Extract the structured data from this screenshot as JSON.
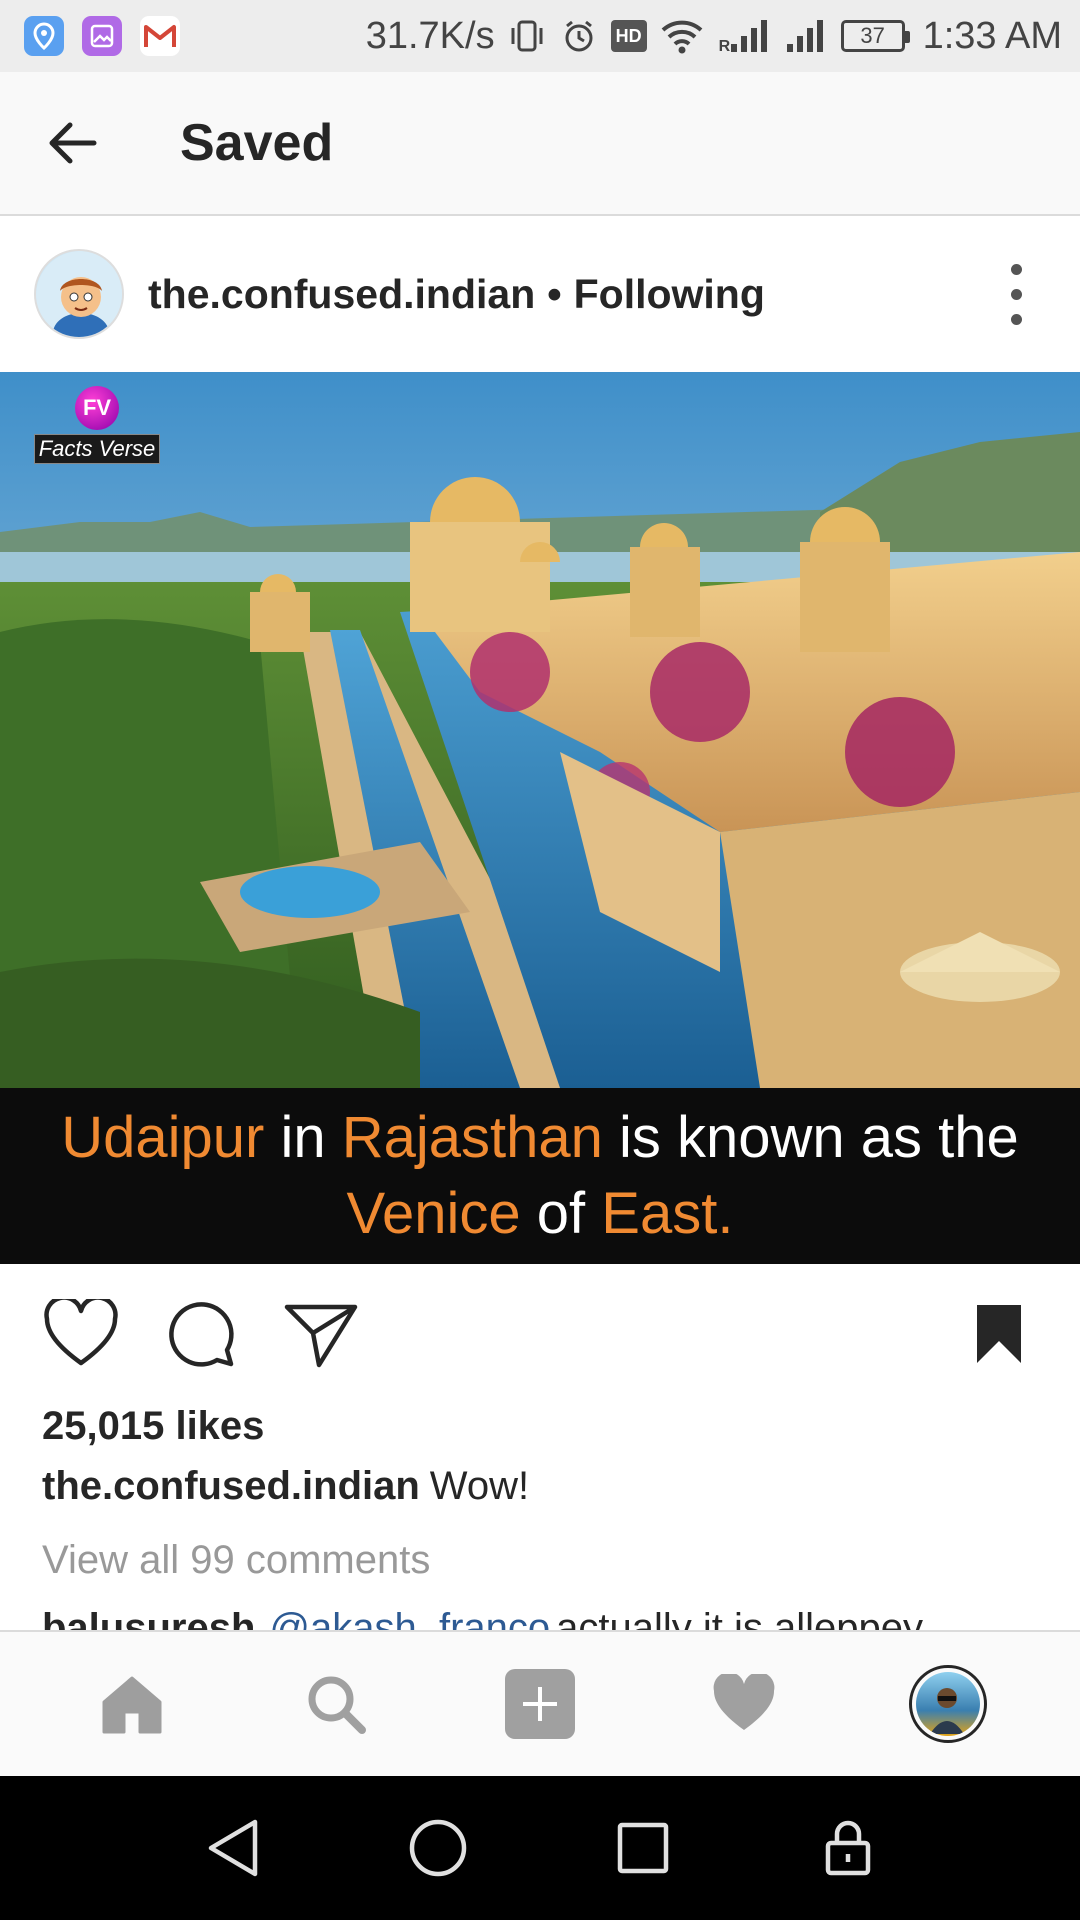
{
  "status_bar": {
    "net_speed": "31.7K/s",
    "hd_label": "HD",
    "signal_roaming_label": "R",
    "battery_level": "37",
    "time": "1:33 AM",
    "app_icons": [
      "maps-icon",
      "gallery-icon",
      "gmail-icon"
    ]
  },
  "header": {
    "title": "Saved"
  },
  "post": {
    "username": "the.confused.indian",
    "separator": "•",
    "follow_status": "Following",
    "image": {
      "watermark_initials": "FV",
      "watermark_text": "Facts Verse",
      "caption_line1": {
        "w1": "Udaipur",
        "w2": " in ",
        "w3": "Rajasthan",
        "w4": " is known as the"
      },
      "caption_line2": {
        "w1": "Venice",
        "w2": " of ",
        "w3": "East."
      }
    },
    "likes": "25,015 likes",
    "caption_user": "the.confused.indian",
    "caption_text": "Wow!",
    "view_comments": "View all 99 comments",
    "comment_peek": {
      "user": "balusuresh",
      "mention": "@akash_franco",
      "text": "actually it is alleppey"
    }
  },
  "colors": {
    "accent_orange": "#f08a32",
    "caption_band": "#0c0c0c",
    "mention_blue": "#2d5a93"
  }
}
